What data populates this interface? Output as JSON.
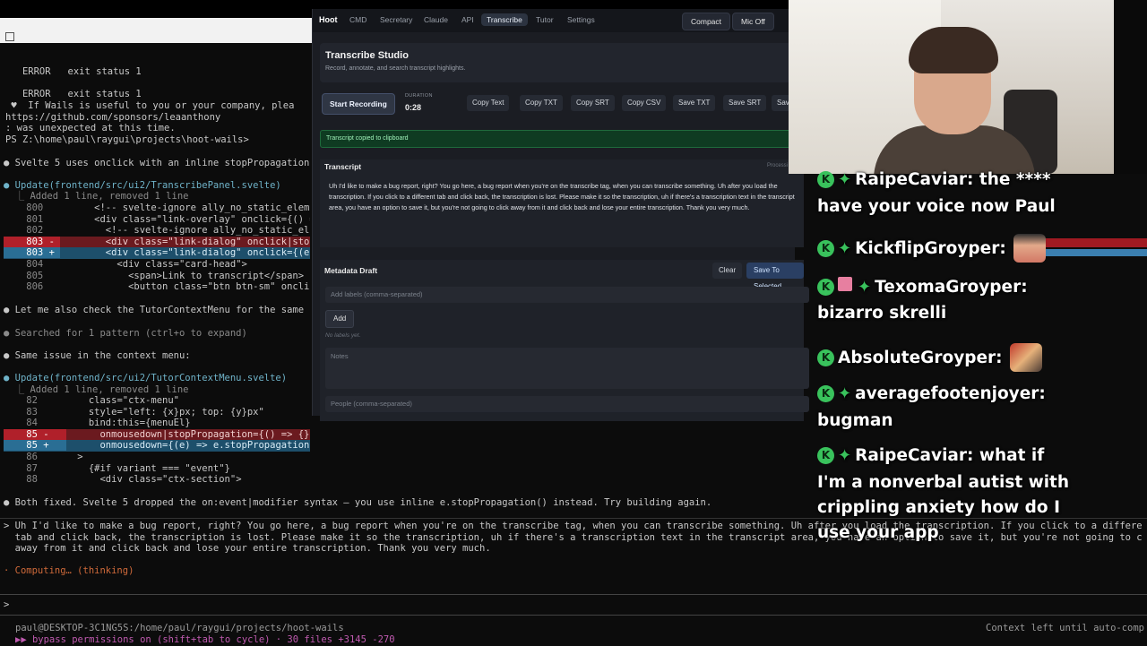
{
  "terminal": {
    "lines_top": [
      {
        "text": "   ERROR   exit status 1",
        "cls": ""
      },
      {
        "text": "   ERROR   exit status 1",
        "cls": ""
      },
      {
        "text": " ♥  If Wails is useful to you or your company, plea",
        "cls": ""
      },
      {
        "text": "https://github.com/sponsors/leaanthony",
        "cls": ""
      },
      {
        "text": ": was unexpected at this time.",
        "cls": ""
      },
      {
        "text": "PS Z:\\home\\paul\\raygui\\projects\\hoot-wails>",
        "cls": ""
      }
    ],
    "svelte_note": "● Svelte 5 uses onclick with an inline stopPropagation",
    "update1": {
      "header": "● Update(frontend/src/ui2/TranscribePanel.svelte)",
      "summary": "  ⎿ Added 1 line, removed 1 line",
      "rows": [
        {
          "num": "800",
          "text": "      <!-- svelte-ignore ally_no_static_eleme",
          "kind": "ctx"
        },
        {
          "num": "801",
          "text": "      <div class=\"link-overlay\" onclick={() =",
          "kind": "ctx"
        },
        {
          "num": "802",
          "text": "        <!-- svelte-ignore ally_no_static_ele",
          "kind": "ctx"
        },
        {
          "num": "803 -",
          "text": "        <div class=\"link-dialog\" onclick|stop",
          "kind": "del"
        },
        {
          "num": "803 +",
          "text": "        <div class=\"link-dialog\" onclick={(e)",
          "kind": "add"
        },
        {
          "num": "804",
          "text": "          <div class=\"card-head\">",
          "kind": "ctx"
        },
        {
          "num": "805",
          "text": "            <span>Link to transcript</span>",
          "kind": "ctx"
        },
        {
          "num": "806",
          "text": "            <button class=\"btn btn-sm\" onclic",
          "kind": "ctx"
        }
      ]
    },
    "check_line": "● Let me also check the TutorContextMenu for the same",
    "searched_line": "● Searched for 1 pattern (ctrl+o to expand)",
    "same_issue_line": "● Same issue in the context menu:",
    "update2": {
      "header": "● Update(frontend/src/ui2/TutorContextMenu.svelte)",
      "summary": "  ⎿ Added 1 line, removed 1 line",
      "rows": [
        {
          "num": "82",
          "text": "      class=\"ctx-menu\"",
          "kind": "ctx"
        },
        {
          "num": "83",
          "text": "      style=\"left: {x}px; top: {y}px\"",
          "kind": "ctx"
        },
        {
          "num": "84",
          "text": "      bind:this={menuEl}",
          "kind": "ctx"
        },
        {
          "num": "85 -",
          "text": "      onmousedown|stopPropagation={() => {}}",
          "kind": "del"
        },
        {
          "num": "85 +",
          "text": "      onmousedown={(e) => e.stopPropagation()}",
          "kind": "add"
        },
        {
          "num": "86",
          "text": "    >",
          "kind": "ctx"
        },
        {
          "num": "87",
          "text": "      {#if variant === \"event\"}",
          "kind": "ctx"
        },
        {
          "num": "88",
          "text": "        <div class=\"ctx-section\">",
          "kind": "ctx"
        }
      ]
    },
    "both_fixed": "● Both fixed. Svelte 5 dropped the on:event|modifier syntax — you use inline e.stopPropagation() instead. Try building again.",
    "user_msg_lines": [
      "> Uh I'd like to make a bug report, right? You go here, a bug report when you're on the transcribe tag, when you can transcribe something. Uh after you load the transcription. If you click to a differe",
      "  tab and click back, the transcription is lost. Please make it so the transcription, uh if there's a transcription text in the transcript area, you have an option to save it, but you're not going to c",
      "  away from it and click back and lose your entire transcription. Thank you very much."
    ],
    "computing": "· Computing… (thinking)",
    "prompt_char": ">",
    "status_path": "paul@DESKTOP-3C1NG5S:/home/paul/raygui/projects/hoot-wails",
    "status_bypass": "▶▶ bypass permissions on (shift+tab to cycle) · 30 files +3145 -270",
    "context_left": "Context left until auto-comp"
  },
  "app": {
    "nav": {
      "brand": "Hoot",
      "items": [
        "CMD",
        "Secretary",
        "Claude",
        "API",
        "Transcribe",
        "Tutor",
        "Settings"
      ],
      "active": "Transcribe",
      "compact": "Compact",
      "mic": "Mic Off"
    },
    "studio": {
      "title": "Transcribe Studio",
      "subtitle": "Record, annotate, and search transcript highlights."
    },
    "toolbar": {
      "record": "Start Recording",
      "duration_label": "DURATION",
      "duration": "0:28",
      "buttons": [
        "Copy Text",
        "Copy TXT",
        "Copy SRT",
        "Copy CSV",
        "Save TXT",
        "Save SRT",
        "Sav"
      ]
    },
    "toast": "Transcript copied to clipboard",
    "transcript": {
      "heading": "Transcript",
      "processing": "Processi",
      "text": "Uh I'd like to make a bug report, right? You go here, a bug report when you're on the transcribe tag, when you can transcribe something. Uh after you load the transcription. If you click to a different tab and click back, the transcription is lost. Please make it so the transcription, uh if there's a transcription text in the transcript area, you have an option to save it, but you're not going to click away from it and click back and lose your entire transcription. Thank you very much."
    },
    "metadata": {
      "heading": "Metadata Draft",
      "clear": "Clear",
      "save_selected": "Save To Selected",
      "labels_placeholder": "Add labels (comma-separated)",
      "add": "Add",
      "no_labels": "No labels yet.",
      "notes_placeholder": "Notes",
      "people_placeholder": "People (comma-separated)"
    }
  },
  "chat": {
    "messages": [
      {
        "user": "RaipeCaviar:",
        "text": "the ****",
        "cont": "have your voice now Paul"
      },
      {
        "user": "KickflipGroyper:",
        "text": "",
        "emote": "emote1"
      },
      {
        "user": "TexomaGroyper:",
        "text": "",
        "cont": "bizarro skrelli"
      },
      {
        "user": "AbsoluteGroyper:",
        "text": "",
        "emote": "emote2"
      },
      {
        "user": "averagefootenjoyer:",
        "text": "",
        "cont": "bugman"
      },
      {
        "user": "RaipeCaviar:",
        "text": "what if",
        "cont": "I'm a nonverbal autist with",
        "cont2": "crippling anxiety how do I",
        "cont3": "use your app"
      }
    ],
    "colors": {
      "badge": "#39c25c"
    }
  }
}
